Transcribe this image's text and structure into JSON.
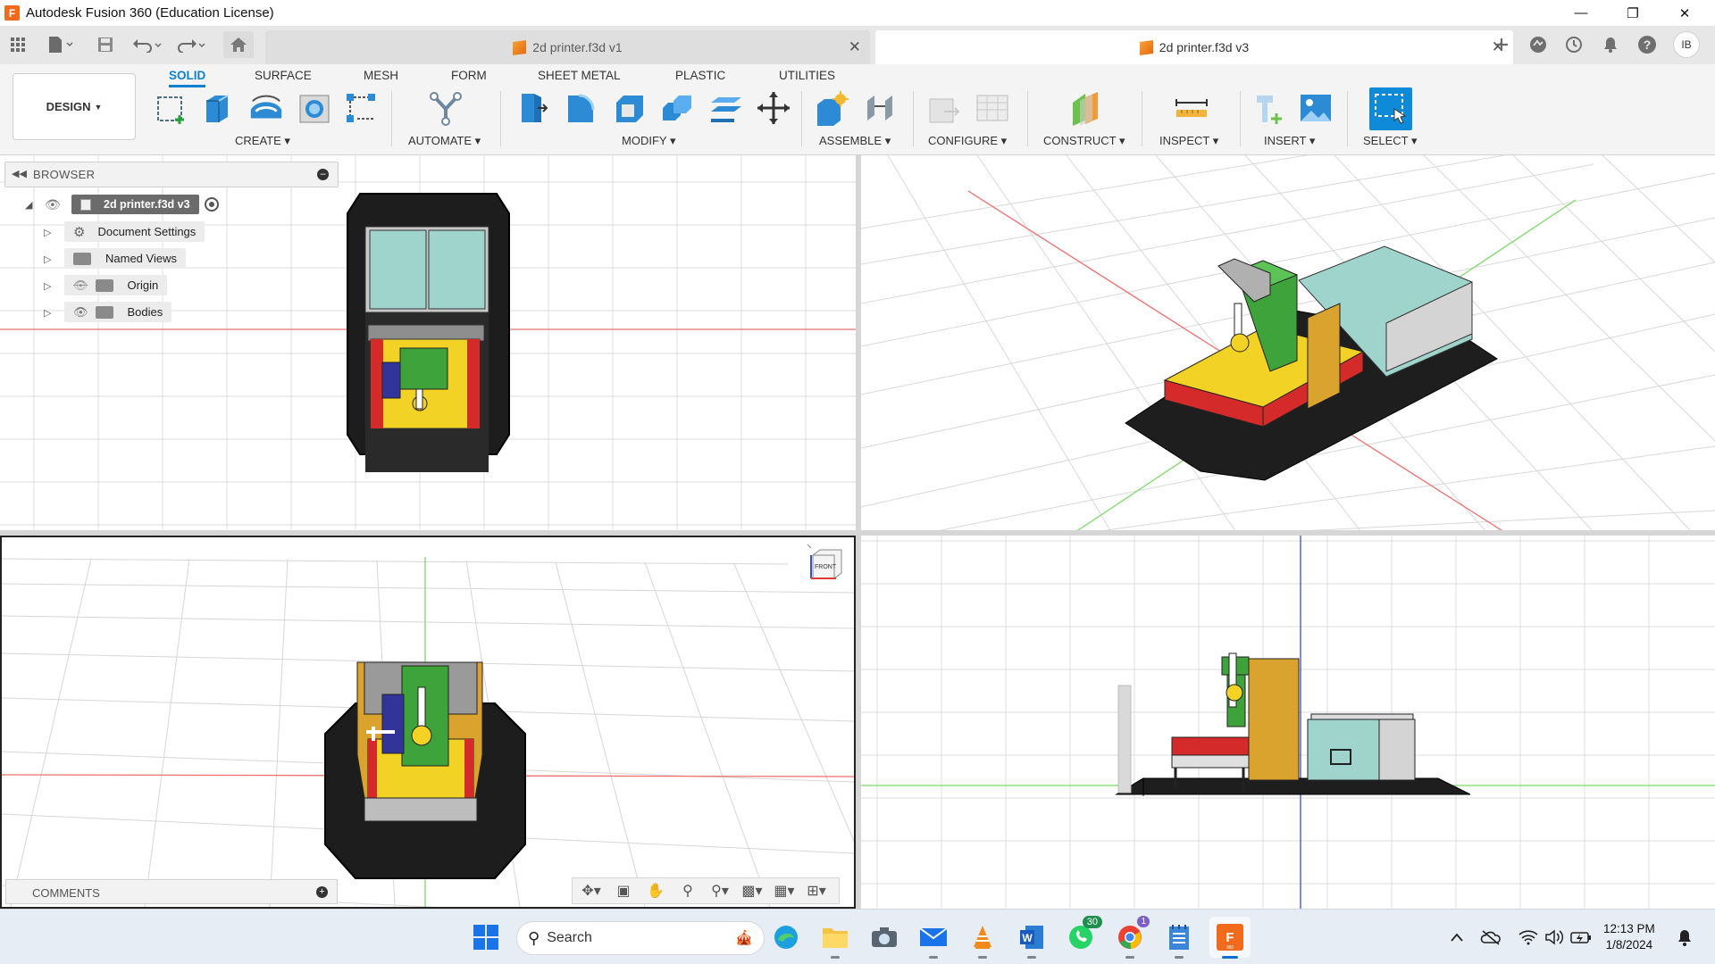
{
  "window": {
    "title": "Autodesk Fusion 360 (Education License)",
    "controls": [
      "minimize-icon",
      "restore-icon",
      "close-icon"
    ]
  },
  "tabs": [
    {
      "label": "2d printer.f3d v1",
      "active": false
    },
    {
      "label": "2d printer.f3d v3",
      "active": true
    }
  ],
  "header_right": {
    "user_initials": "IB"
  },
  "ribbon": {
    "workspace": "DESIGN",
    "tabs": [
      "SOLID",
      "SURFACE",
      "MESH",
      "FORM",
      "SHEET METAL",
      "PLASTIC",
      "UTILITIES"
    ],
    "active_tab": "SOLID",
    "groups": [
      "CREATE",
      "AUTOMATE",
      "MODIFY",
      "ASSEMBLE",
      "CONFIGURE",
      "CONSTRUCT",
      "INSPECT",
      "INSERT",
      "SELECT"
    ]
  },
  "browser": {
    "title": "BROWSER",
    "root": "2d printer.f3d v3",
    "items": [
      "Document Settings",
      "Named Views",
      "Origin",
      "Bodies"
    ]
  },
  "comments": {
    "title": "COMMENTS"
  },
  "viewcube": {
    "label": "FRONT"
  },
  "taskbar": {
    "search_placeholder": "Search",
    "whatsapp_badge": "30",
    "chrome_badge": "1",
    "time": "12:13 PM",
    "date": "1/8/2024"
  },
  "colors": {
    "accent": "#0f7fd0",
    "grid": "#dcdcdc",
    "axis_red": "#e53935",
    "axis_green": "#6cc24a",
    "axis_blue": "#3b4fd6",
    "model_yellow": "#f3d226",
    "model_green": "#3ea33a",
    "model_glass": "#9fd4cc",
    "model_orange": "#d9a32e",
    "model_red": "#d42a2a"
  }
}
